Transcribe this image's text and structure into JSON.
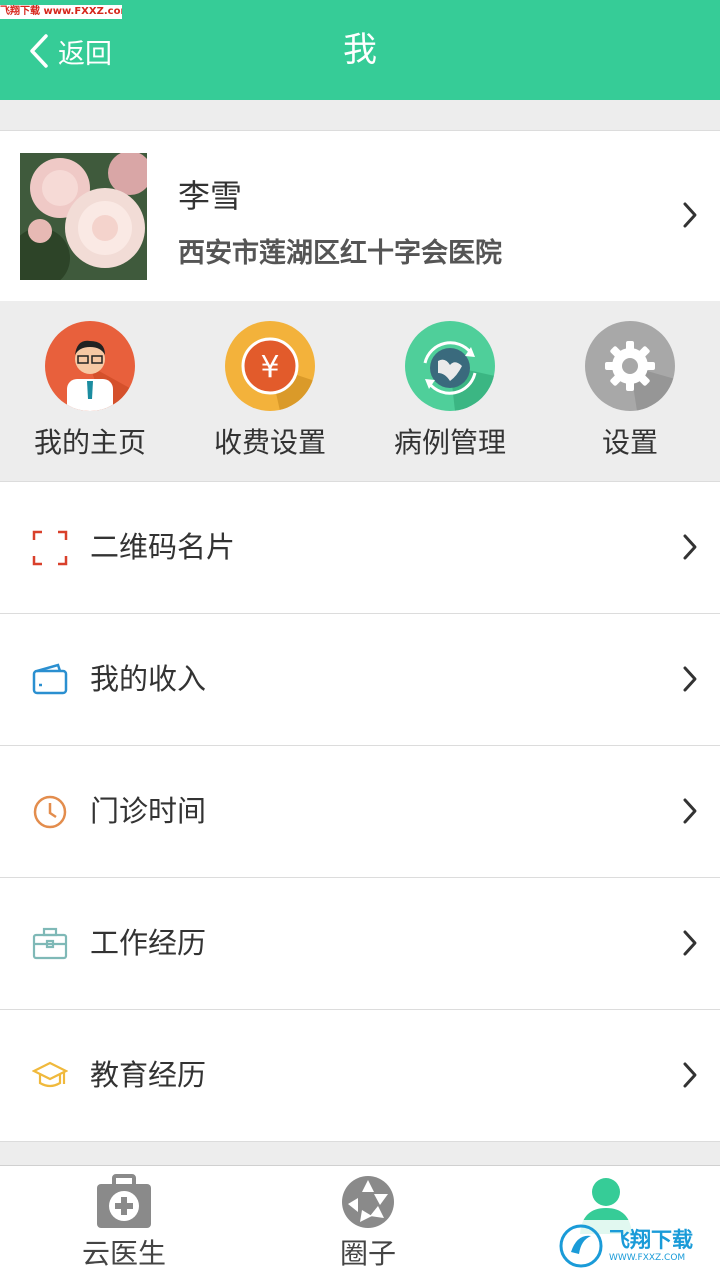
{
  "watermark_top": "飞翔下载 www.FXXZ.com",
  "header": {
    "back_label": "返回",
    "title": "我"
  },
  "profile": {
    "name": "李雪",
    "hospital": "西安市莲湖区红十字会医院"
  },
  "quick_actions": [
    {
      "label": "我的主页",
      "icon": "doctor-avatar-icon",
      "color": "#e8603c"
    },
    {
      "label": "收费设置",
      "icon": "yuan-icon",
      "color": "#f3b23b"
    },
    {
      "label": "病例管理",
      "icon": "globe-refresh-icon",
      "color": "#4fcf9a"
    },
    {
      "label": "设置",
      "icon": "gear-icon",
      "color": "#a8a8a8"
    }
  ],
  "menu": [
    {
      "label": "二维码名片",
      "icon": "qr-scan-icon"
    },
    {
      "label": "我的收入",
      "icon": "wallet-icon"
    },
    {
      "label": "门诊时间",
      "icon": "clock-icon"
    },
    {
      "label": "工作经历",
      "icon": "briefcase-icon"
    },
    {
      "label": "教育经历",
      "icon": "graduation-cap-icon"
    }
  ],
  "tabs": [
    {
      "label": "云医生",
      "icon": "medical-kit-icon"
    },
    {
      "label": "圈子",
      "icon": "aperture-icon"
    },
    {
      "label": "",
      "icon": "doctor-profile-icon"
    }
  ],
  "watermark_bottom": {
    "main": "飞翔下载",
    "sub": "WWW.FXXZ.COM"
  },
  "colors": {
    "accent": "#36cc97",
    "background": "#ededed"
  }
}
